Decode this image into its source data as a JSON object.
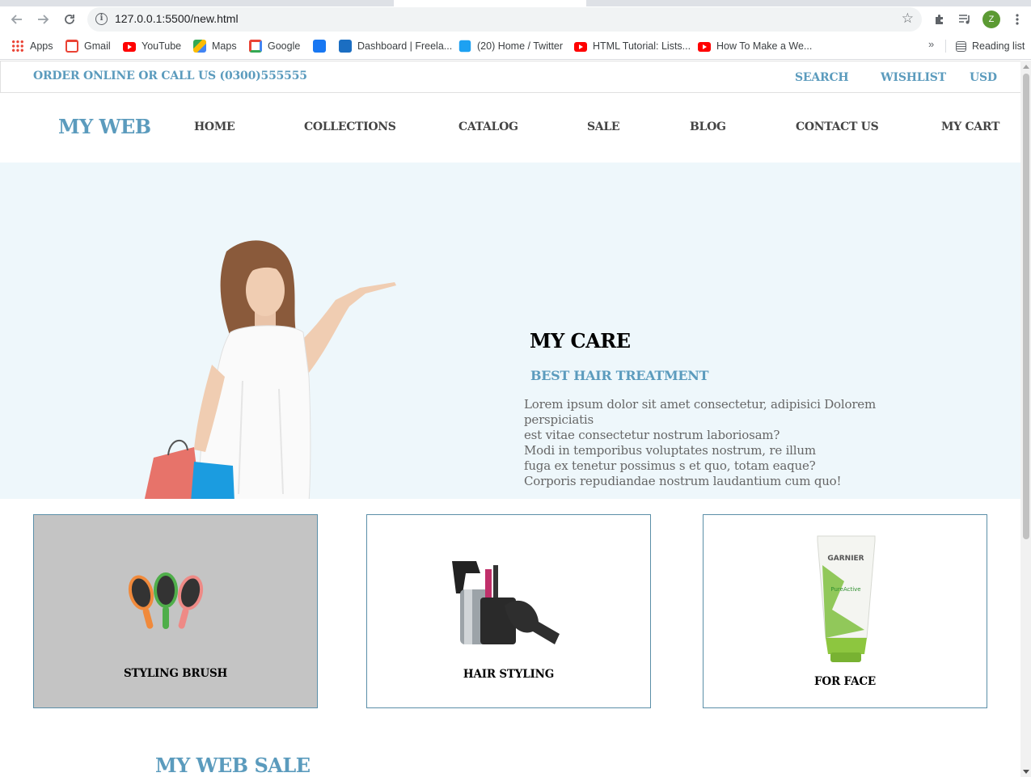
{
  "browser": {
    "url": "127.0.0.1:5500/new.html",
    "profile_initial": "Z",
    "bookmarks": [
      {
        "label": "Apps",
        "icon": "apps-grid-icon"
      },
      {
        "label": "Gmail",
        "icon": "gmail-icon"
      },
      {
        "label": "YouTube",
        "icon": "youtube-icon"
      },
      {
        "label": "Maps",
        "icon": "maps-icon"
      },
      {
        "label": "Google",
        "icon": "google-icon"
      },
      {
        "label": "",
        "icon": "facebook-icon"
      },
      {
        "label": "Dashboard | Freela...",
        "icon": "freelancer-icon"
      },
      {
        "label": "(20) Home / Twitter",
        "icon": "twitter-icon"
      },
      {
        "label": "HTML Tutorial: Lists...",
        "icon": "youtube-icon"
      },
      {
        "label": "How To Make a We...",
        "icon": "youtube-icon"
      }
    ],
    "more_bookmarks": "»",
    "reading_list": "Reading list"
  },
  "topbar": {
    "phone": "ORDER ONLINE OR CALL US (0300)555555",
    "links": [
      "SEARCH",
      "WISHLIST",
      "USD"
    ]
  },
  "navbar": {
    "brand": "MY WEB",
    "items": [
      "HOME",
      "COLLECTIONS",
      "CATALOG",
      "SALE",
      "BLOG",
      "CONTACT US",
      "MY CART"
    ]
  },
  "hero": {
    "title": "MY CARE",
    "subtitle": "BEST HAIR TREATMENT",
    "text_lines": [
      "Lorem ipsum dolor sit amet consectetur, adipisici Dolorem",
      "perspiciatis",
      "est vitae consectetur nostrum laboriosam?",
      "Modi in temporibus voluptates nostrum, re illum",
      "fuga ex tenetur possimus s et quo, totam eaque?",
      "Corporis repudiandae nostrum laudantium cum quo!"
    ]
  },
  "cards": [
    {
      "label": "STYLING BRUSH",
      "image": "hair-brushes-image"
    },
    {
      "label": "HAIR STYLING",
      "image": "hair-styling-tools-image"
    },
    {
      "label": "FOR FACE",
      "image": "face-wash-tube-image"
    }
  ],
  "product_texts": {
    "tube_brand": "GARNIER",
    "tube_line": "PureActive"
  },
  "colors": {
    "accent": "#5b9bbd",
    "hero_bg": "#eef7fb",
    "card_border": "#5b8fa8",
    "card_hover_bg": "#c4c4c4"
  },
  "sale_section": {
    "title": "MY WEB SALE"
  }
}
